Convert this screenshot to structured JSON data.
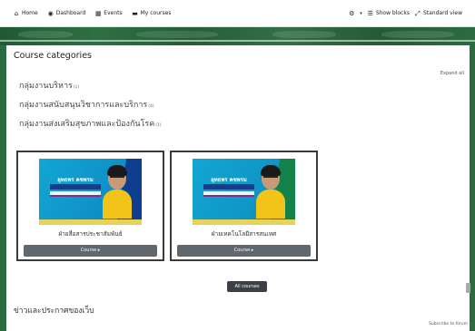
{
  "navbar": {
    "items": [
      {
        "label": "Home",
        "icon": "home-icon"
      },
      {
        "label": "Dashboard",
        "icon": "dashboard-icon"
      },
      {
        "label": "Events",
        "icon": "calendar-icon"
      },
      {
        "label": "My courses",
        "icon": "courses-icon"
      }
    ],
    "show_blocks": "Show blocks",
    "standard_view": "Standard view"
  },
  "page": {
    "title": "Course categories",
    "expand_all": "Expand all"
  },
  "categories": [
    {
      "name": "กลุ่มงานบริหาร",
      "count": "(1)"
    },
    {
      "name": "กลุ่มงานสนับสนุนวิชาการและบริการ",
      "count": "(4)"
    },
    {
      "name": "กลุ่มงานส่งเสริมสุขภาพและป้องกันโรค",
      "count": "(1)"
    }
  ],
  "courses": [
    {
      "title": "ฝ่ายสื่อสารประชาสัมพันธ์",
      "button": "Course ▸",
      "image_heading": "ยุทธพร คชพรม"
    },
    {
      "title": "ฝ่ายเทคโนโลยีสารสนเทศ",
      "button": "Course ▸",
      "image_heading": "ยุทธพร คชพรม"
    }
  ],
  "all_courses": "All courses",
  "news": {
    "title": "ข่าวและประกาศของเว็บ",
    "subscribe": "Subscribe to forum"
  },
  "colors": {
    "banner": "#2c6b3f",
    "button": "#60676d",
    "all_courses_button": "#3a4045"
  }
}
